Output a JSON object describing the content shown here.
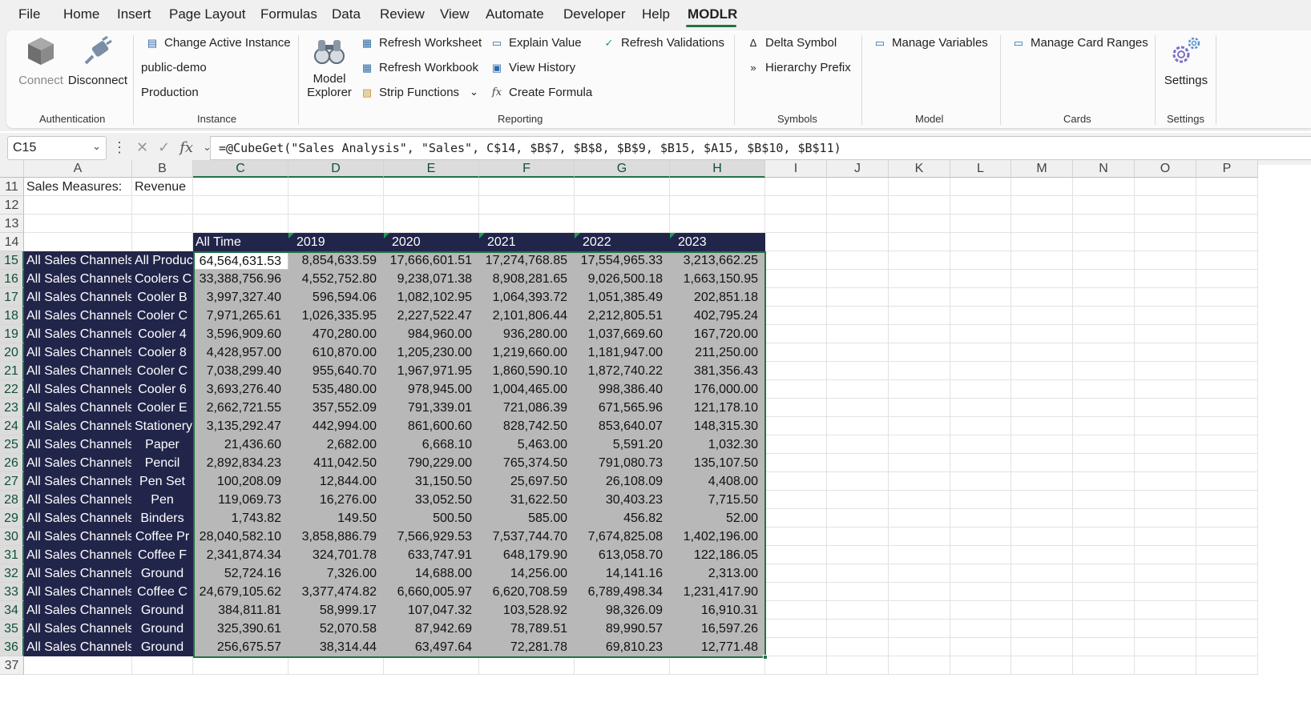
{
  "menu": [
    "File",
    "Home",
    "Insert",
    "Page Layout",
    "Formulas",
    "Data",
    "Review",
    "View",
    "Automate",
    "Developer",
    "Help",
    "MODLR"
  ],
  "ribbon": {
    "authentication": {
      "connect": "Connect",
      "disconnect": "Disconnect",
      "label": "Authentication"
    },
    "instance": {
      "change": "Change Active Instance",
      "name": "public-demo",
      "env": "Production",
      "label": "Instance"
    },
    "reporting": {
      "model_explorer_line1": "Model",
      "model_explorer_line2": "Explorer",
      "refresh_worksheet": "Refresh Worksheet",
      "refresh_workbook": "Refresh Workbook",
      "strip_functions": "Strip Functions",
      "explain_value": "Explain Value",
      "view_history": "View History",
      "create_formula": "Create Formula",
      "refresh_validations": "Refresh Validations",
      "label": "Reporting"
    },
    "symbols": {
      "delta": "Delta Symbol",
      "hierarchy": "Hierarchy Prefix",
      "label": "Symbols"
    },
    "model": {
      "manage_variables": "Manage Variables",
      "label": "Model"
    },
    "cards": {
      "manage_card_ranges": "Manage Card Ranges",
      "label": "Cards"
    },
    "settings": {
      "settings": "Settings",
      "label": "Settings"
    }
  },
  "formula_bar": {
    "name_box": "C15",
    "formula": "=@CubeGet(\"Sales Analysis\", \"Sales\", C$14, $B$7, $B$8, $B$9, $B15, $A15, $B$10, $B$11)"
  },
  "columns": [
    "A",
    "B",
    "C",
    "D",
    "E",
    "F",
    "G",
    "H",
    "I",
    "J",
    "K",
    "L",
    "M",
    "N",
    "O",
    "P"
  ],
  "sheet": {
    "row11": {
      "num": "11",
      "a": "Sales Measures:",
      "b": "Revenue"
    },
    "empty_rows": [
      "12",
      "13"
    ],
    "header_row": {
      "num": "14",
      "cols": [
        "All Time",
        "2019",
        "2020",
        "2021",
        "2022",
        "2023"
      ]
    },
    "last_row_num": "37",
    "rows": [
      {
        "num": "15",
        "a": "All Sales Channels",
        "b": "All Products",
        "v": [
          "64,564,631.53",
          "8,854,633.59",
          "17,666,601.51",
          "17,274,768.85",
          "17,554,965.33",
          "3,213,662.25"
        ]
      },
      {
        "num": "16",
        "a": "All Sales Channels",
        "b": "Coolers C",
        "v": [
          "33,388,756.96",
          "4,552,752.80",
          "9,238,071.38",
          "8,908,281.65",
          "9,026,500.18",
          "1,663,150.95"
        ]
      },
      {
        "num": "17",
        "a": "All Sales Channels",
        "b": "Cooler B",
        "v": [
          "3,997,327.40",
          "596,594.06",
          "1,082,102.95",
          "1,064,393.72",
          "1,051,385.49",
          "202,851.18"
        ]
      },
      {
        "num": "18",
        "a": "All Sales Channels",
        "b": "Cooler C",
        "v": [
          "7,971,265.61",
          "1,026,335.95",
          "2,227,522.47",
          "2,101,806.44",
          "2,212,805.51",
          "402,795.24"
        ]
      },
      {
        "num": "19",
        "a": "All Sales Channels",
        "b": "Cooler 4",
        "v": [
          "3,596,909.60",
          "470,280.00",
          "984,960.00",
          "936,280.00",
          "1,037,669.60",
          "167,720.00"
        ]
      },
      {
        "num": "20",
        "a": "All Sales Channels",
        "b": "Cooler 8",
        "v": [
          "4,428,957.00",
          "610,870.00",
          "1,205,230.00",
          "1,219,660.00",
          "1,181,947.00",
          "211,250.00"
        ]
      },
      {
        "num": "21",
        "a": "All Sales Channels",
        "b": "Cooler C",
        "v": [
          "7,038,299.40",
          "955,640.70",
          "1,967,971.95",
          "1,860,590.10",
          "1,872,740.22",
          "381,356.43"
        ]
      },
      {
        "num": "22",
        "a": "All Sales Channels",
        "b": "Cooler 6",
        "v": [
          "3,693,276.40",
          "535,480.00",
          "978,945.00",
          "1,004,465.00",
          "998,386.40",
          "176,000.00"
        ]
      },
      {
        "num": "23",
        "a": "All Sales Channels",
        "b": "Cooler E",
        "v": [
          "2,662,721.55",
          "357,552.09",
          "791,339.01",
          "721,086.39",
          "671,565.96",
          "121,178.10"
        ]
      },
      {
        "num": "24",
        "a": "All Sales Channels",
        "b": "Stationery",
        "v": [
          "3,135,292.47",
          "442,994.00",
          "861,600.60",
          "828,742.50",
          "853,640.07",
          "148,315.30"
        ]
      },
      {
        "num": "25",
        "a": "All Sales Channels",
        "b": "Paper",
        "v": [
          "21,436.60",
          "2,682.00",
          "6,668.10",
          "5,463.00",
          "5,591.20",
          "1,032.30"
        ]
      },
      {
        "num": "26",
        "a": "All Sales Channels",
        "b": "Pencil",
        "v": [
          "2,892,834.23",
          "411,042.50",
          "790,229.00",
          "765,374.50",
          "791,080.73",
          "135,107.50"
        ]
      },
      {
        "num": "27",
        "a": "All Sales Channels",
        "b": "Pen Set",
        "v": [
          "100,208.09",
          "12,844.00",
          "31,150.50",
          "25,697.50",
          "26,108.09",
          "4,408.00"
        ]
      },
      {
        "num": "28",
        "a": "All Sales Channels",
        "b": "Pen",
        "v": [
          "119,069.73",
          "16,276.00",
          "33,052.50",
          "31,622.50",
          "30,403.23",
          "7,715.50"
        ]
      },
      {
        "num": "29",
        "a": "All Sales Channels",
        "b": "Binders",
        "v": [
          "1,743.82",
          "149.50",
          "500.50",
          "585.00",
          "456.82",
          "52.00"
        ]
      },
      {
        "num": "30",
        "a": "All Sales Channels",
        "b": "Coffee Pr",
        "v": [
          "28,040,582.10",
          "3,858,886.79",
          "7,566,929.53",
          "7,537,744.70",
          "7,674,825.08",
          "1,402,196.00"
        ]
      },
      {
        "num": "31",
        "a": "All Sales Channels",
        "b": "Coffee F",
        "v": [
          "2,341,874.34",
          "324,701.78",
          "633,747.91",
          "648,179.90",
          "613,058.70",
          "122,186.05"
        ]
      },
      {
        "num": "32",
        "a": "All Sales Channels",
        "b": "Ground",
        "v": [
          "52,724.16",
          "7,326.00",
          "14,688.00",
          "14,256.00",
          "14,141.16",
          "2,313.00"
        ]
      },
      {
        "num": "33",
        "a": "All Sales Channels",
        "b": "Coffee C",
        "v": [
          "24,679,105.62",
          "3,377,474.82",
          "6,660,005.97",
          "6,620,708.59",
          "6,789,498.34",
          "1,231,417.90"
        ]
      },
      {
        "num": "34",
        "a": "All Sales Channels",
        "b": "Ground",
        "v": [
          "384,811.81",
          "58,999.17",
          "107,047.32",
          "103,528.92",
          "98,326.09",
          "16,910.31"
        ]
      },
      {
        "num": "35",
        "a": "All Sales Channels",
        "b": "Ground",
        "v": [
          "325,390.61",
          "52,070.58",
          "87,942.69",
          "78,789.51",
          "89,990.57",
          "16,597.26"
        ]
      },
      {
        "num": "36",
        "a": "All Sales Channels",
        "b": "Ground",
        "v": [
          "256,675.57",
          "38,314.44",
          "63,497.64",
          "72,281.78",
          "69,810.23",
          "12,771.48"
        ]
      }
    ]
  },
  "colors": {
    "accent": "#217346",
    "header_dark": "#22254a",
    "selection": "#b8b8b8"
  }
}
